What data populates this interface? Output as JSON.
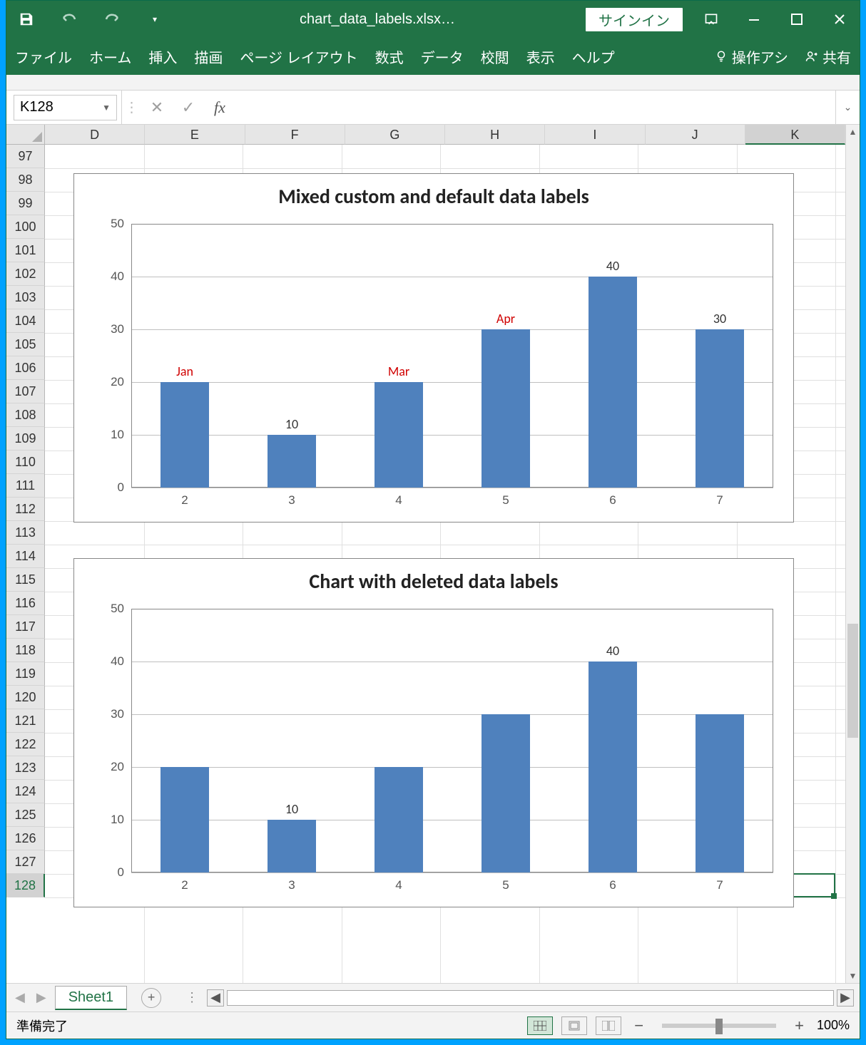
{
  "title": "chart_data_labels.xlsx…",
  "signin": "サインイン",
  "ribbon": {
    "file": "ファイル",
    "home": "ホーム",
    "insert": "挿入",
    "draw": "描画",
    "pagelayout": "ページ レイアウト",
    "formulas": "数式",
    "data": "データ",
    "review": "校閲",
    "view": "表示",
    "help": "ヘルプ",
    "tellme": "操作アシ",
    "share": "共有"
  },
  "namebox": "K128",
  "formula": "",
  "columns": [
    "D",
    "E",
    "F",
    "G",
    "H",
    "I",
    "J",
    "K"
  ],
  "selected_col": "K",
  "rows_start": 97,
  "rows_end": 128,
  "selected_row": 128,
  "sheet_tab": "Sheet1",
  "status": "準備完了",
  "zoom": "100%",
  "chart_data": [
    {
      "type": "bar",
      "title": "Mixed custom and default data labels",
      "categories": [
        "2",
        "3",
        "4",
        "5",
        "6",
        "7"
      ],
      "values": [
        20,
        10,
        20,
        30,
        40,
        30
      ],
      "data_labels": [
        {
          "text": "Jan",
          "color": "red"
        },
        {
          "text": "10",
          "color": "black"
        },
        {
          "text": "Mar",
          "color": "red"
        },
        {
          "text": "Apr",
          "color": "red"
        },
        {
          "text": "40",
          "color": "black"
        },
        {
          "text": "30",
          "color": "black"
        }
      ],
      "ylim": [
        0,
        50
      ],
      "ytick": 10
    },
    {
      "type": "bar",
      "title": "Chart with deleted data labels",
      "categories": [
        "2",
        "3",
        "4",
        "5",
        "6",
        "7"
      ],
      "values": [
        20,
        10,
        20,
        30,
        40,
        30
      ],
      "data_labels": [
        null,
        {
          "text": "10",
          "color": "black"
        },
        null,
        null,
        {
          "text": "40",
          "color": "black"
        },
        null
      ],
      "ylim": [
        0,
        50
      ],
      "ytick": 10
    }
  ]
}
